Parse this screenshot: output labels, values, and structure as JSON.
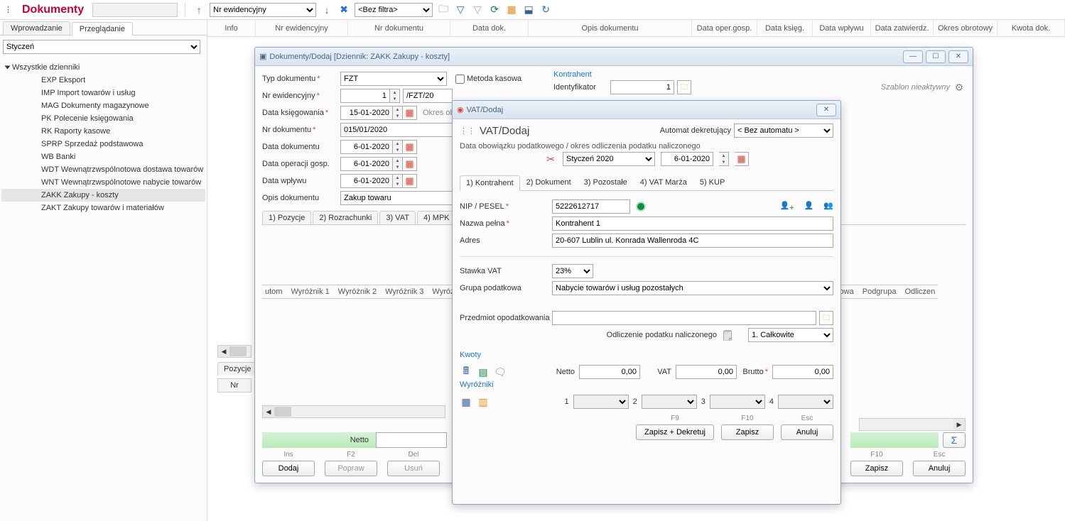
{
  "header": {
    "title": "Dokumenty",
    "sort_field": "Nr ewidencyjny",
    "filter": "<Bez filtra>"
  },
  "sidebar": {
    "tab_entry": "Wprowadzanie",
    "tab_browse": "Przeglądanie",
    "month": "Styczeń",
    "tree_root": "Wszystkie dzienniki",
    "items": [
      "EXP Eksport",
      "IMP Import towarów i usług",
      "MAG Dokumenty magazynowe",
      "PK Polecenie księgowania",
      "RK Raporty kasowe",
      "SPRP Sprzedaż podstawowa",
      "WB Banki",
      "WDT Wewnątrzwspólnotowa dostawa towarów",
      "WNT Wewnątrzwspólnotowe nabycie towarów",
      "ZAKK Zakupy - koszty",
      "ZAKT Zakupy towarów i materiałów"
    ],
    "selected_index": 9
  },
  "grid": {
    "cols": [
      "Info",
      "Nr ewidencyjny",
      "Nr dokumentu",
      "Data dok.",
      "Opis dokumentu",
      "Data oper.gosp.",
      "Data księg.",
      "Data wpływu",
      "Data zatwierdz.",
      "Okres obrotowy",
      "Kwota dok."
    ]
  },
  "lower": {
    "tab": "Pozycje",
    "col": "Nr"
  },
  "dlg_doc": {
    "title": "Dokumenty/Dodaj [Dziennik: ZAKK  Zakupy - koszty]",
    "labels": {
      "typ": "Typ dokumentu",
      "nrew": "Nr ewidencyjny",
      "dataks": "Data księgowania",
      "nrdok": "Nr dokumentu",
      "datadok": "Data dokumentu",
      "dataop": "Data operacji gosp.",
      "datawp": "Data wpływu",
      "opis": "Opis dokumentu",
      "kontrahent": "Kontrahent",
      "ident": "Identyfikator",
      "szablon": "Szablon nieaktywny",
      "metoda": "Metoda kasowa",
      "okres": "Okres ob"
    },
    "values": {
      "typ": "FZT",
      "nrew_no": "1",
      "nrew_ser": "/FZT/20",
      "dataks": "15-01-2020",
      "nrdok": "015/01/2020",
      "datadok": "6-01-2020",
      "dataop": "6-01-2020",
      "datawp": "6-01-2020",
      "opis": "Zakup towaru",
      "ident": "1"
    },
    "tabs": [
      "1) Pozycje",
      "2) Rozrachunki",
      "3) VAT",
      "4) MPK"
    ],
    "col_heads": [
      "utom",
      "Wyróżnik 1",
      "Wyróżnik 2",
      "Wyróżnik 3",
      "Wyróżnik"
    ],
    "col_heads_right": [
      "owa",
      "Podgrupa",
      "Odliczen"
    ],
    "netto": "Netto",
    "buttons": {
      "ins": "Ins",
      "dodaj": "Dodaj",
      "f2": "F2",
      "popraw": "Popraw",
      "del": "Del",
      "usun": "Usuń",
      "f10": "F10",
      "zapisz": "Zapisz",
      "esc": "Esc",
      "anuluj": "Anuluj"
    }
  },
  "dlg_vat": {
    "title": "VAT/Dodaj",
    "heading": "VAT/Dodaj",
    "automat": "Automat dekretujący",
    "automat_val": "< Bez automatu >",
    "okres_label": "Data obowiązku podatkowego / okres odliczenia podatku naliczonego",
    "okres_val": "Styczeń 2020",
    "okres_date": "6-01-2020",
    "tabs": [
      "1) Kontrahent",
      "2) Dokument",
      "3) Pozostałe",
      "4) VAT Marża",
      "5) KUP"
    ],
    "fields": {
      "nip_label": "NIP / PESEL",
      "nip": "5222612717",
      "nazwa_label": "Nazwa pełna",
      "nazwa": "Kontrahent 1",
      "adres_label": "Adres",
      "adres": "20-607 Lublin ul. Konrada Wallenroda 4C",
      "stawka_label": "Stawka VAT",
      "stawka": "23%",
      "grupa_label": "Grupa podatkowa",
      "grupa": "Nabycie towarów i usług pozostałych",
      "przedmiot_label": "Przedmiot opodatkowania",
      "odlicz_label": "Odliczenie podatku naliczonego",
      "odlicz_val": "1. Całkowite"
    },
    "kwoty": {
      "section": "Kwoty",
      "netto": "Netto",
      "netto_v": "0,00",
      "vat": "VAT",
      "vat_v": "0,00",
      "brutto": "Brutto",
      "brutto_v": "0,00"
    },
    "wyrozniki": {
      "section": "Wyróżniki",
      "l1": "1",
      "l2": "2",
      "l3": "3",
      "l4": "4"
    },
    "buttons": {
      "f9": "F9",
      "zd": "Zapisz + Dekretuj",
      "f10": "F10",
      "zapisz": "Zapisz",
      "esc": "Esc",
      "anuluj": "Anuluj"
    }
  }
}
